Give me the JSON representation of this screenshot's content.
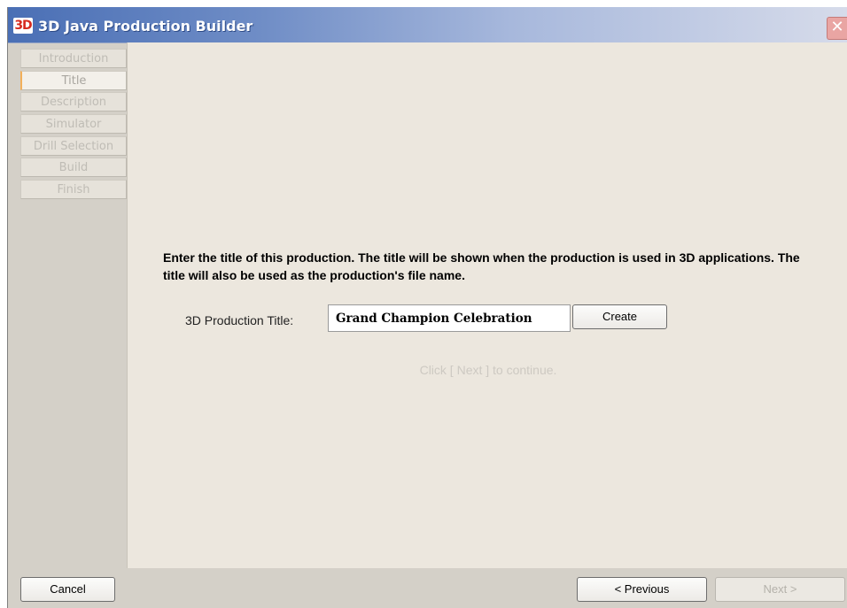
{
  "window": {
    "title": "3D Java Production Builder",
    "logo_text": "3D"
  },
  "sidebar": {
    "steps": [
      {
        "label": "Introduction",
        "active": false
      },
      {
        "label": "Title",
        "active": true
      },
      {
        "label": "Description",
        "active": false
      },
      {
        "label": "Simulator",
        "active": false
      },
      {
        "label": "Drill Selection",
        "active": false
      },
      {
        "label": "Build",
        "active": false
      },
      {
        "label": "Finish",
        "active": false
      }
    ]
  },
  "main": {
    "instructions": "Enter the title of this production.  The title will be shown when the production is used in 3D applications.  The title will also be used as the production's file name.",
    "field_label": "3D Production Title:",
    "title_value": "Grand Champion Celebration",
    "create_label": "Create",
    "hint": "Click  [ Next ]  to continue."
  },
  "footer": {
    "cancel_label": "Cancel",
    "previous_label": "< Previous",
    "next_label": "Next >"
  },
  "colors": {
    "accent": "#f3b05a",
    "content_bg": "#ece7de",
    "titlebar_start": "#4a6fb5"
  }
}
